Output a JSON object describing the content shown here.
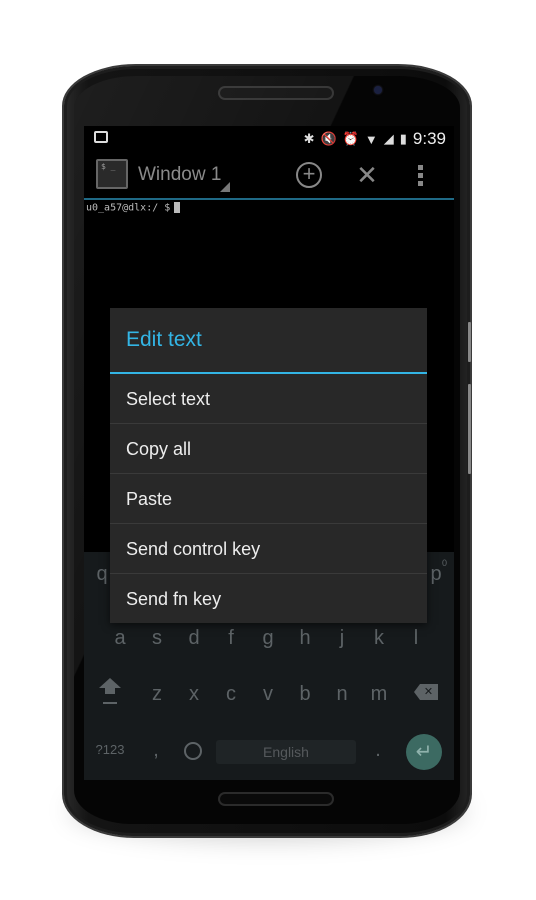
{
  "status_bar": {
    "app_icon": "terminal-icon",
    "icons": [
      "bluetooth-icon",
      "mute-icon",
      "alarm-icon",
      "wifi-icon",
      "signal-icon",
      "battery-charging-icon"
    ],
    "time": "9:39"
  },
  "action_bar": {
    "window_title": "Window 1",
    "actions": [
      "add-window",
      "close-window",
      "overflow-menu"
    ]
  },
  "terminal": {
    "prompt": "u0_a57@dlx:/ $"
  },
  "dialog": {
    "title": "Edit text",
    "items": [
      {
        "label": "Select text"
      },
      {
        "label": "Copy all"
      },
      {
        "label": "Paste"
      },
      {
        "label": "Send control key"
      },
      {
        "label": "Send fn key"
      }
    ],
    "accent_color": "#33b5e5"
  },
  "keyboard": {
    "row1_visible": {
      "left": "q",
      "right": "p",
      "right_hint": "0"
    },
    "row2": [
      "a",
      "s",
      "d",
      "f",
      "g",
      "h",
      "j",
      "k",
      "l"
    ],
    "row3": [
      "z",
      "x",
      "c",
      "v",
      "b",
      "n",
      "m"
    ],
    "symbols_label": "?123",
    "comma": ",",
    "space_label": "English",
    "period": ".",
    "enter_color": "#3c6a62"
  }
}
